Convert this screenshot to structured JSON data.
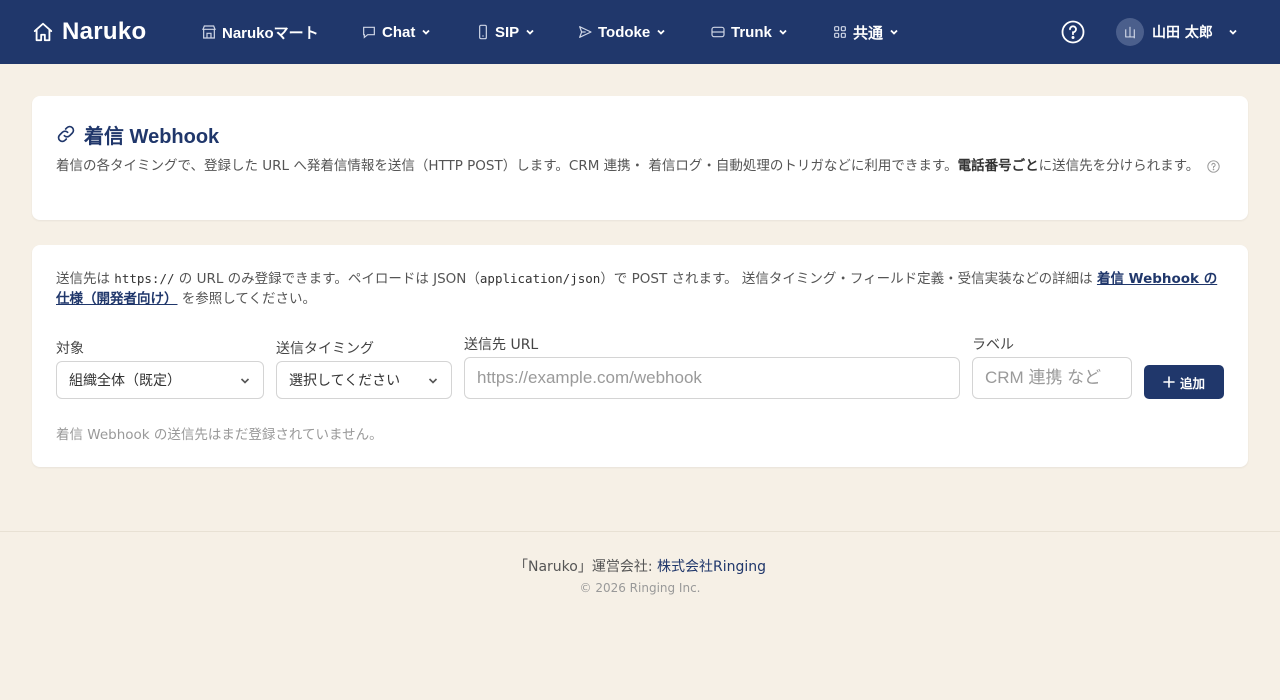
{
  "nav": {
    "brand": "Naruko",
    "items": [
      {
        "label": "Narukoマート",
        "icon": "store-icon"
      },
      {
        "label": "Chat",
        "icon": "chat-icon"
      },
      {
        "label": "SIP",
        "icon": "phone-icon"
      },
      {
        "label": "Todoke",
        "icon": "send-icon"
      },
      {
        "label": "Trunk",
        "icon": "database-icon"
      },
      {
        "label": "共通",
        "icon": "grid-icon"
      }
    ],
    "user": {
      "avatar_initial": "山",
      "name": "山田 太郎"
    }
  },
  "header": {
    "title": "着信 Webhook",
    "description_pre": "着信の各タイミングで、登録した URL へ発着信情報を送信（HTTP POST）します。CRM 連携・ 着信ログ・自動処理のトリガなどに利用できます。",
    "description_bold": "電話番号ごと",
    "description_post": "に送信先を分けられます。"
  },
  "form": {
    "info_1": "送信先は ",
    "info_code_1": "https://",
    "info_2": " の URL のみ登録できます。ペイロードは JSON（",
    "info_code_2": "application/json",
    "info_3": "）で POST されます。 送信タイミング・フィールド定義・受信実装などの詳細は ",
    "info_link": "着信 Webhook の仕様（開発者向け）",
    "info_4": " を参照してください。",
    "target_label": "対象",
    "target_value": "組織全体（既定）",
    "timing_label": "送信タイミング",
    "timing_value": "選択してください",
    "url_label": "送信先 URL",
    "url_placeholder": "https://example.com/webhook",
    "label_label": "ラベル",
    "label_placeholder": "CRM 連携 など",
    "add_button": "追加",
    "empty_message": "着信 Webhook の送信先はまだ登録されていません。"
  },
  "footer": {
    "operator_prefix": "「Naruko」運営会社: ",
    "operator_link": "株式会社Ringing",
    "copyright": "© 2026 Ringing Inc."
  },
  "colors": {
    "nav_bg": "#20376b",
    "page_bg": "#f6f0e6",
    "accent": "#20376b"
  }
}
